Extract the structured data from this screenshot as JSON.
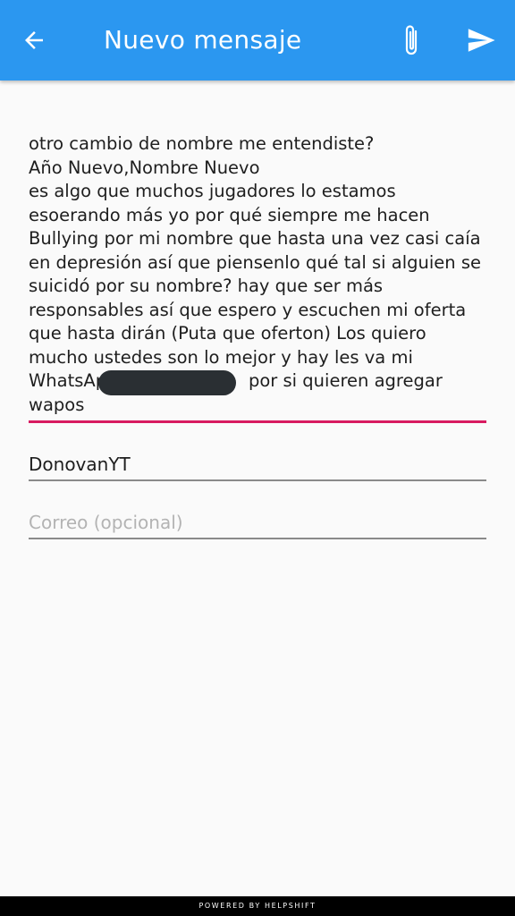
{
  "appbar": {
    "title": "Nuevo mensaje",
    "back_icon": "arrow-back-icon",
    "attach_icon": "paperclip-icon",
    "send_icon": "send-icon"
  },
  "form": {
    "message": "otro cambio de nombre me entendiste?\nAño Nuevo,Nombre Nuevo\nes algo que muchos jugadores lo estamos esoerando más yo por qué siempre me hacen Bullying por mi nombre que hasta una vez casi caía en depresión así que piensenlo qué tal si alguien se suicidó por su nombre? hay que ser más responsables así que espero y escuchen mi oferta que hasta dirán (Puta que oferton) Los quiero mucho ustedes son lo mejor y hay les va mi WhatsApp +                    por si quieren agregar wapos",
    "name_value": "DonovanYT",
    "email_placeholder": "Correo (opcional)"
  },
  "footer": {
    "text": "POWERED BY HELPSHIFT"
  },
  "colors": {
    "primary": "#2b97f0",
    "accent": "#d81b60"
  }
}
